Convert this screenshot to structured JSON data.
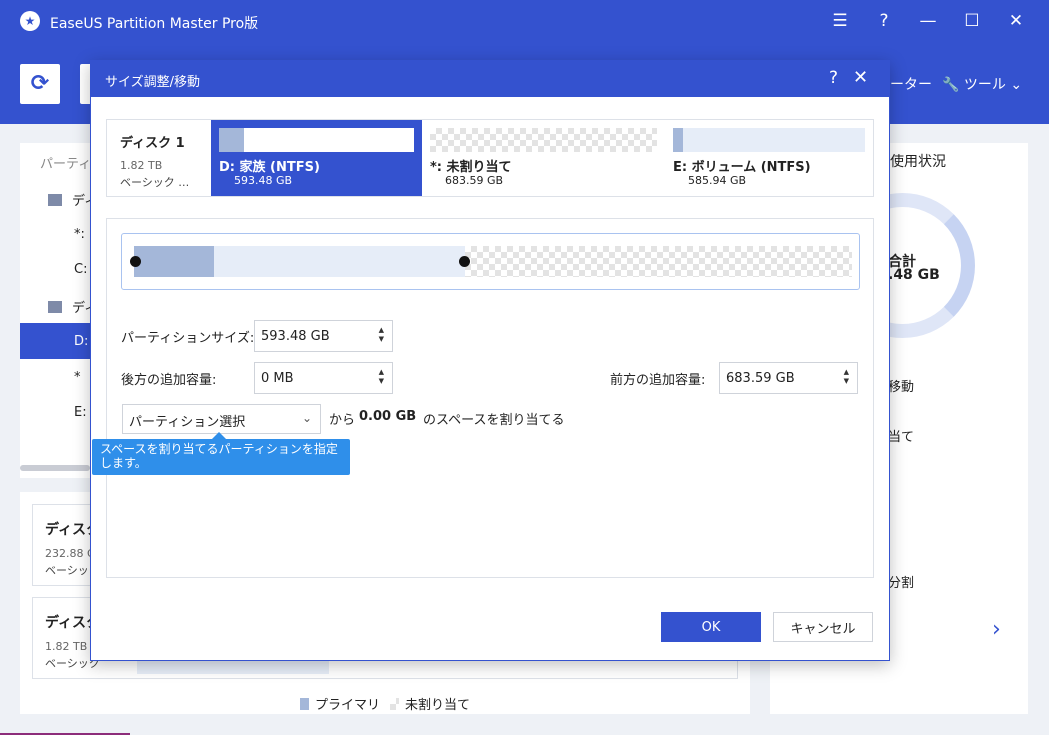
{
  "app": {
    "title": "EaseUS Partition Master Pro版",
    "menu_icon": "hamburger-icon",
    "help": "?",
    "minimize": "—",
    "maximize": "☐",
    "close": "✕"
  },
  "toolbar": {
    "refresh_icon": "⟳",
    "cut_text": "ーター",
    "tools_label": "ツール"
  },
  "left_panel": {
    "header": "パーティシ",
    "rows": [
      "ディ",
      "*: :",
      "C:",
      "ディ",
      "D:",
      "*",
      "E:"
    ]
  },
  "bottom_panel": {
    "disks": [
      {
        "name": "ディスク",
        "size": "232.88 G",
        "type": "ベーシック"
      },
      {
        "name": "ディスク",
        "size": "1.82 TB",
        "type": "ベーシック"
      }
    ],
    "legend": {
      "primary": "プライマリ",
      "unallocated": "未割り当て"
    }
  },
  "right_panel": {
    "title": "使用状況",
    "total_label": "合計",
    "total_value": ".48 GB",
    "items": [
      "移動",
      "当て",
      "分割"
    ],
    "next": "›"
  },
  "dialog": {
    "title": "サイズ調整/移動",
    "help": "?",
    "close": "✕",
    "disk": {
      "name": "ディスク 1",
      "size": "1.82 TB",
      "type": "ベーシック …",
      "partitions": [
        {
          "name": "D: 家族 (NTFS)",
          "size": "593.48 GB",
          "used_fraction": 0.13
        },
        {
          "name": "*: 未割り当て",
          "size": "683.59 GB"
        },
        {
          "name": "E: ボリューム (NTFS)",
          "size": "585.94 GB",
          "used_fraction": 0.05
        }
      ]
    },
    "fields": {
      "partition_size_label": "パーティションサイズ:",
      "partition_size_value": "593.48 GB",
      "after_label": "後方の追加容量:",
      "after_value": "0 MB",
      "before_label": "前方の追加容量:",
      "before_value": "683.59 GB"
    },
    "allocate": {
      "select_value": "パーティション選択",
      "from": "から",
      "amount": "0.00 GB",
      "suffix": "のスペースを割り当てる",
      "tooltip": "スペースを割り当てるパーティションを指定します。"
    },
    "buttons": {
      "ok": "OK",
      "cancel": "キャンセル"
    }
  },
  "colors": {
    "accent": "#3452cf",
    "tooltip": "#2f8fea",
    "used_bar": "#a4b7d9"
  }
}
